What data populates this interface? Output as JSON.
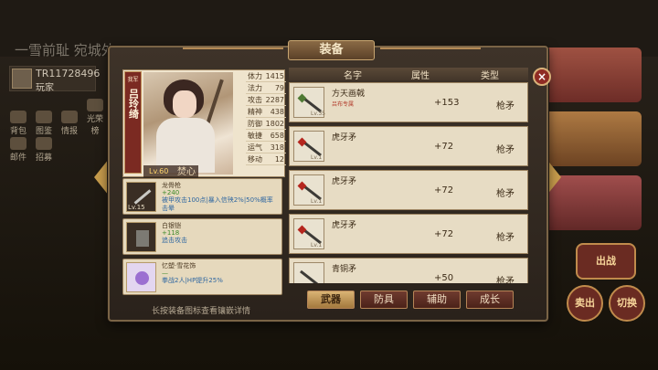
{
  "background": {
    "title": "一雪前耻 宛城外",
    "player_id": "TR11728496",
    "player_type": "玩家",
    "menu": [
      "背包",
      "图鉴",
      "情报",
      "光荣榜",
      "邮件",
      "招募"
    ],
    "buttons": [
      "出战",
      "卖出",
      "切换"
    ]
  },
  "panel": {
    "title": "装备",
    "close_label": "×"
  },
  "hero": {
    "tag": "我军",
    "name": "吕玲绮",
    "level": "Lv.60",
    "stats": [
      {
        "label": "体力",
        "value": "1415"
      },
      {
        "label": "法力",
        "value": "79"
      },
      {
        "label": "攻击",
        "value": "2287"
      },
      {
        "label": "精神",
        "value": "438"
      },
      {
        "label": "防御",
        "value": "1802"
      },
      {
        "label": "敏捷",
        "value": "658"
      },
      {
        "label": "运气",
        "value": "318"
      },
      {
        "label": "移动",
        "value": "12"
      }
    ],
    "section_title": "焚心"
  },
  "equipped": [
    {
      "name": "龙骨枪",
      "bonus": "+240",
      "desc": "被甲攻击100点|暴入信殃2%|50%概率击晕",
      "level": "Lv.15"
    },
    {
      "name": "白银铠",
      "bonus": "+118",
      "desc": "追击攻击",
      "level": ""
    },
    {
      "name": "忆塑·雪花饰",
      "bonus": "—",
      "desc": "拳战2人|HP提升25%",
      "level": ""
    }
  ],
  "hint": "长按装备图标查看镶嵌详情",
  "list": {
    "headers": [
      "名字",
      "属性",
      "类型"
    ],
    "rows": [
      {
        "name": "方天画戟",
        "sub": "吕布专属",
        "attr": "+153",
        "type": "枪矛",
        "level": "Lv.35"
      },
      {
        "name": "虎牙矛",
        "sub": "",
        "attr": "+72",
        "type": "枪矛",
        "level": "Lv.1"
      },
      {
        "name": "虎牙矛",
        "sub": "",
        "attr": "+72",
        "type": "枪矛",
        "level": "Lv.1"
      },
      {
        "name": "虎牙矛",
        "sub": "",
        "attr": "+72",
        "type": "枪矛",
        "level": "Lv.1"
      },
      {
        "name": "青铜矛",
        "sub": "",
        "attr": "+50",
        "type": "枪矛",
        "level": ""
      }
    ]
  },
  "tabs": [
    {
      "label": "武器",
      "active": true
    },
    {
      "label": "防具",
      "active": false
    },
    {
      "label": "辅助",
      "active": false
    },
    {
      "label": "成长",
      "active": false
    }
  ]
}
